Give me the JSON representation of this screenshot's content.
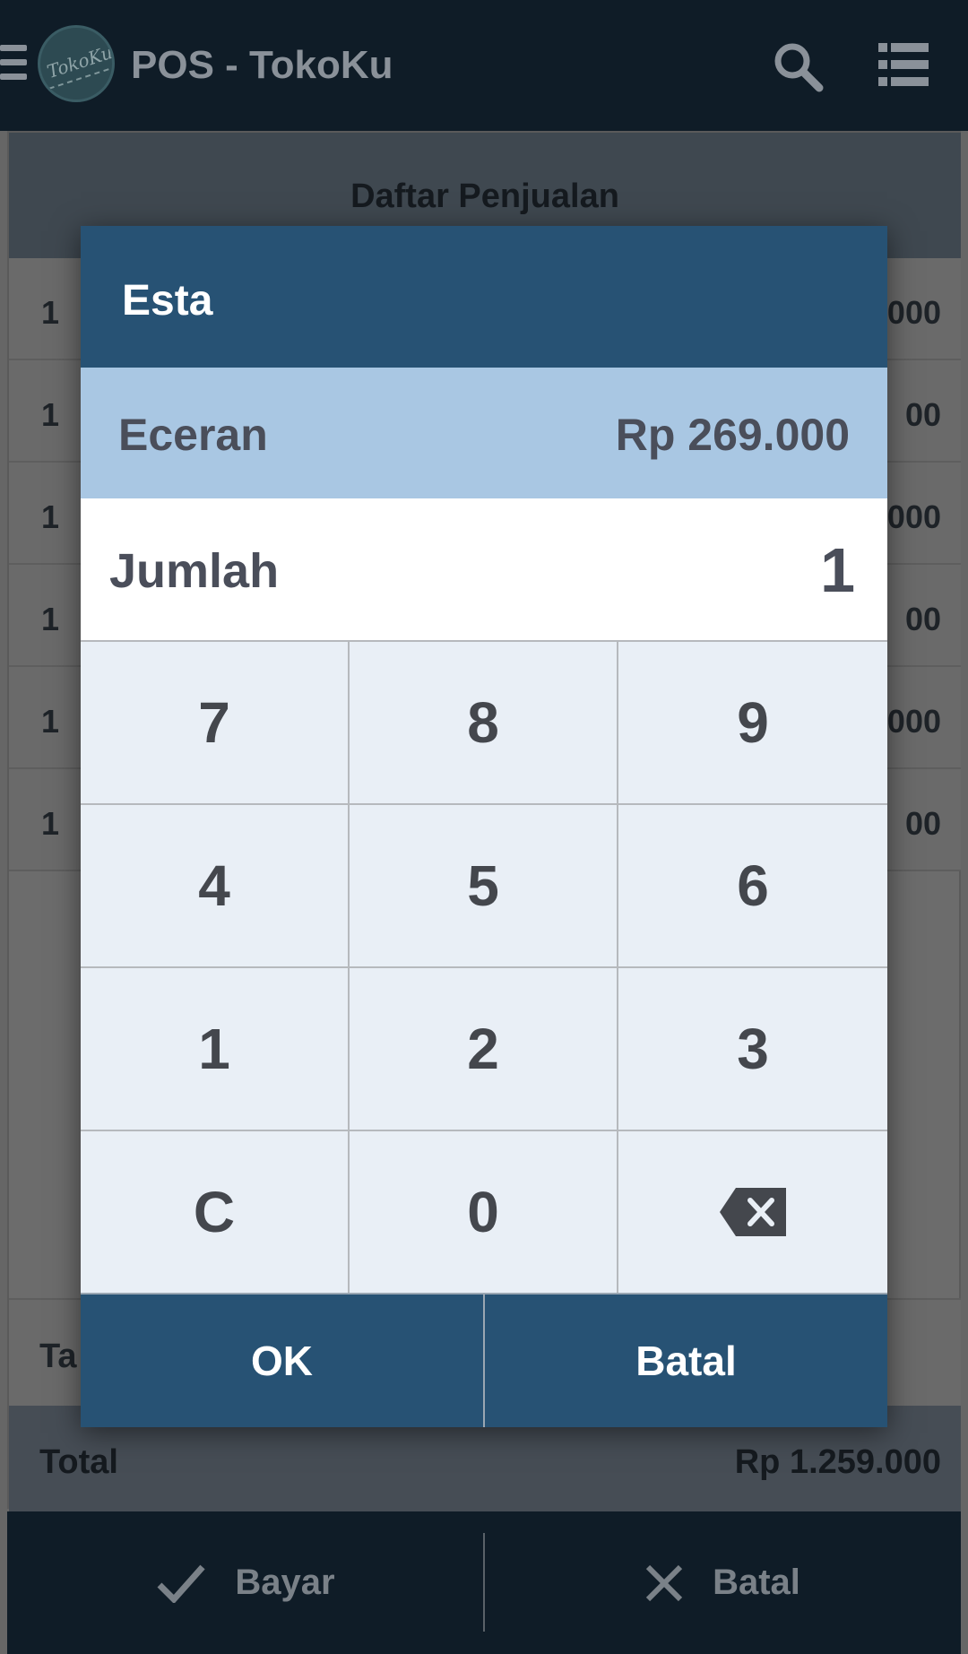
{
  "app": {
    "title": "POS - TokoKu",
    "logo_text": "TokoKu",
    "icons": [
      "menu-icon",
      "search-icon",
      "list-view-icon"
    ]
  },
  "sales_list": {
    "title": "Daftar Penjualan",
    "rows": [
      {
        "qty": "1",
        "price_fragment": "000"
      },
      {
        "qty": "1",
        "price_fragment": "00"
      },
      {
        "qty": "1",
        "price_fragment": "000"
      },
      {
        "qty": "1",
        "price_fragment": "00"
      },
      {
        "qty": "1",
        "price_fragment": "000"
      },
      {
        "qty": "1",
        "price_fragment": "00"
      }
    ],
    "tax_label_fragment": "Ta",
    "total_label": "Total",
    "total_value": "Rp 1.259.000"
  },
  "bottom_bar": {
    "pay_label": "Bayar",
    "cancel_label": "Batal"
  },
  "dialog": {
    "title": "Esta",
    "price_type": "Eceran",
    "price_value": "Rp 269.000",
    "qty_label": "Jumlah",
    "qty_value": "1",
    "keys": [
      "7",
      "8",
      "9",
      "4",
      "5",
      "6",
      "1",
      "2",
      "3",
      "C",
      "0",
      "backspace-icon"
    ],
    "ok_label": "OK",
    "cancel_label": "Batal"
  },
  "colors": {
    "topbar": "#0f1c27",
    "dialog_header": "#275274",
    "price_band": "#a9c7e3",
    "keypad_bg": "#e9eff6"
  }
}
